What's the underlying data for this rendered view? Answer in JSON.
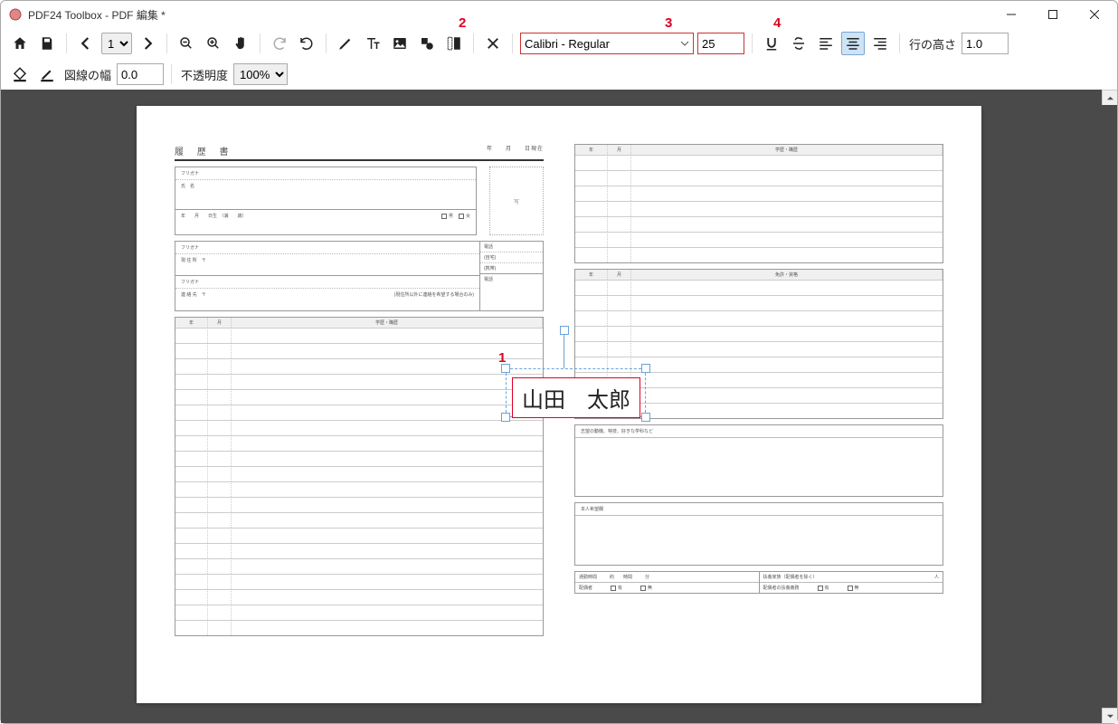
{
  "window": {
    "title": "PDF24 Toolbox - PDF 編集 *"
  },
  "toolbar": {
    "page_value": "1",
    "font_family": "Calibri - Regular",
    "font_size": "25",
    "line_height_label": "行の高さ",
    "line_height_value": "1.0",
    "line_width_label": "図線の幅",
    "line_width_value": "0.0",
    "opacity_label": "不透明度",
    "opacity_value": "100%"
  },
  "annotations": {
    "n1": "1",
    "n2": "2",
    "n3": "3",
    "n4": "4"
  },
  "text_object": {
    "content": "山田　太郎"
  },
  "doc": {
    "title": "履 歴 書",
    "date_suffix": "年　　月　　日現在",
    "photo": "写",
    "furigana": "フリガナ",
    "name_label": "氏　名",
    "birth_row": "年　　月　　日生　（満　　歳）",
    "male": "男",
    "female": "女",
    "addr_label": "現 住 所　〒",
    "contact_label": "連 絡 先　〒",
    "contact_note": "(現住所以外に連絡を希望する場合のみ)",
    "tel": "電話",
    "home": "(自宅)",
    "mobile": "(携帯)",
    "left_table_head": {
      "year": "年",
      "month": "月",
      "title": "学歴・職歴"
    },
    "right_table1_head": {
      "year": "年",
      "month": "月",
      "title": "学歴・職歴"
    },
    "right_table2_head": {
      "year": "年",
      "month": "月",
      "title": "免許・資格"
    },
    "motive": "志望の動機、特技、好きな学科など",
    "wish": "本人希望欄",
    "commute": "通勤時間",
    "commute_unit_h": "約　　時間",
    "commute_unit_m": "分",
    "dependents": "扶養家族（配偶者を除く）",
    "dependents_unit": "人",
    "spouse": "配偶者",
    "yes": "有",
    "no": "無",
    "spouse_support": "配偶者の扶養義務"
  }
}
